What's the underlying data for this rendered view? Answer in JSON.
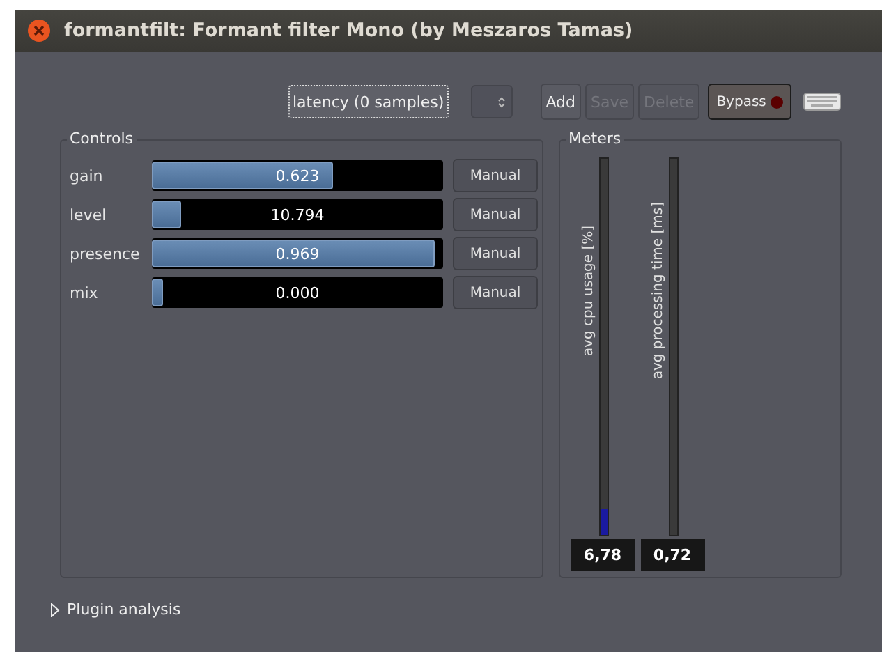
{
  "window": {
    "title": "formantfilt: Formant filter Mono (by Meszaros Tamas)"
  },
  "toolbar": {
    "latency": "latency (0 samples)",
    "buttons": [
      {
        "label": "Add",
        "disabled": false
      },
      {
        "label": "Save",
        "disabled": true
      },
      {
        "label": "Delete",
        "disabled": true
      }
    ],
    "bypass": {
      "label": "Bypass",
      "on": false
    }
  },
  "controls": {
    "title": "Controls",
    "rows": [
      {
        "name": "gain",
        "level": 0.623,
        "value": "0.623",
        "button": "Manual"
      },
      {
        "name": "level",
        "level": 0.1,
        "value": "10.794",
        "button": "Manual"
      },
      {
        "name": "presence",
        "level": 0.969,
        "value": "0.969",
        "button": "Manual"
      },
      {
        "name": "mix",
        "level": 0.04,
        "value": "0.000",
        "button": "Manual"
      }
    ]
  },
  "meters": {
    "title": "Meters",
    "items": [
      {
        "label": "avg cpu usage [%]",
        "level": 0.07,
        "value": "6,78"
      },
      {
        "label": "avg processing time [ms]",
        "value": "0,72"
      }
    ]
  },
  "expander": {
    "label": "Plugin analysis",
    "expanded": false
  }
}
